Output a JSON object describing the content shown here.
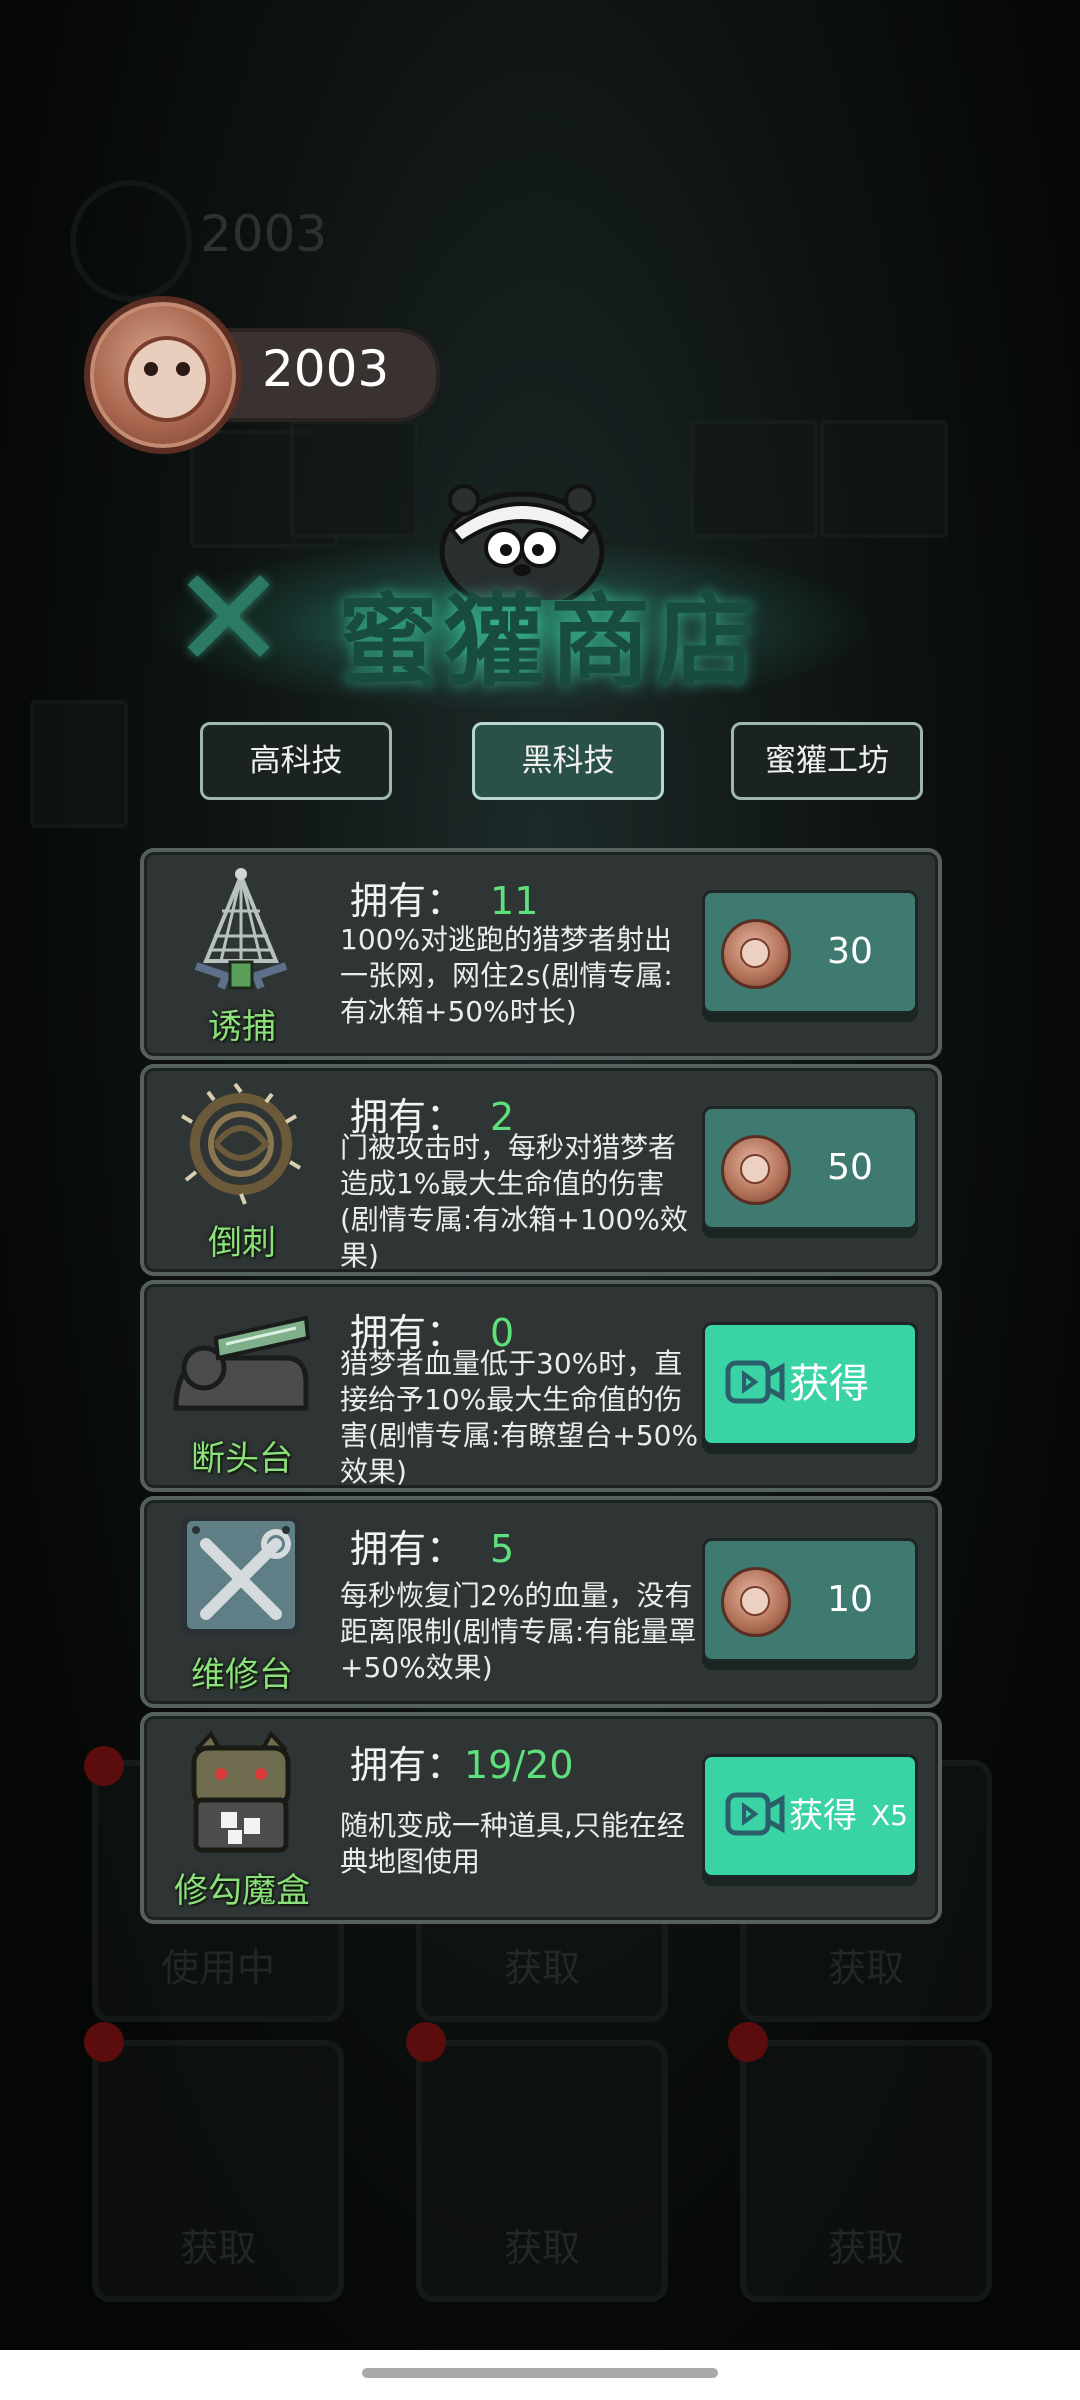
{
  "header": {
    "coins": "2003"
  },
  "shop": {
    "title": "蜜獾商店"
  },
  "tabs": [
    {
      "label": "高科技",
      "active": false
    },
    {
      "label": "黑科技",
      "active": true
    },
    {
      "label": "蜜獾工坊",
      "active": false
    }
  ],
  "items": [
    {
      "name": "诱捕",
      "own_label": "拥有：",
      "count": "11",
      "desc": "100%对逃跑的猎梦者射出一张网，网住2s(剧情专属:有冰箱+50%时长)",
      "action": {
        "type": "coin",
        "price": "30"
      }
    },
    {
      "name": "倒刺",
      "own_label": "拥有：",
      "count": "2",
      "desc": "门被攻击时，每秒对猎梦者造成1%最大生命值的伤害(剧情专属:有冰箱+100%效果)",
      "action": {
        "type": "coin",
        "price": "50"
      }
    },
    {
      "name": "断头台",
      "own_label": "拥有：",
      "count": "0",
      "desc": "猎梦者血量低于30%时，直接给予10%最大生命值的伤害(剧情专属:有瞭望台+50%效果)",
      "action": {
        "type": "video",
        "label": "获得"
      }
    },
    {
      "name": "维修台",
      "own_label": "拥有：",
      "count": "5",
      "desc": "每秒恢复门2%的血量，没有距离限制(剧情专属:有能量罩+50%效果)",
      "action": {
        "type": "coin",
        "price": "10"
      }
    },
    {
      "name": "修勾魔盒",
      "own_label": "拥有：",
      "count": "19/20",
      "desc": "随机变成一种道具,只能在经典地图使用",
      "action": {
        "type": "video",
        "label": "获得",
        "multiplier": "X5"
      }
    }
  ],
  "background": {
    "ghost_coin_value": "2003",
    "card_labels": [
      "使用中",
      "获取",
      "获取",
      "获取",
      "获取",
      "获取"
    ]
  },
  "colors": {
    "accent": "#39d3a5",
    "count_green": "#5ee07d",
    "coin_button": "#3f7a70"
  }
}
